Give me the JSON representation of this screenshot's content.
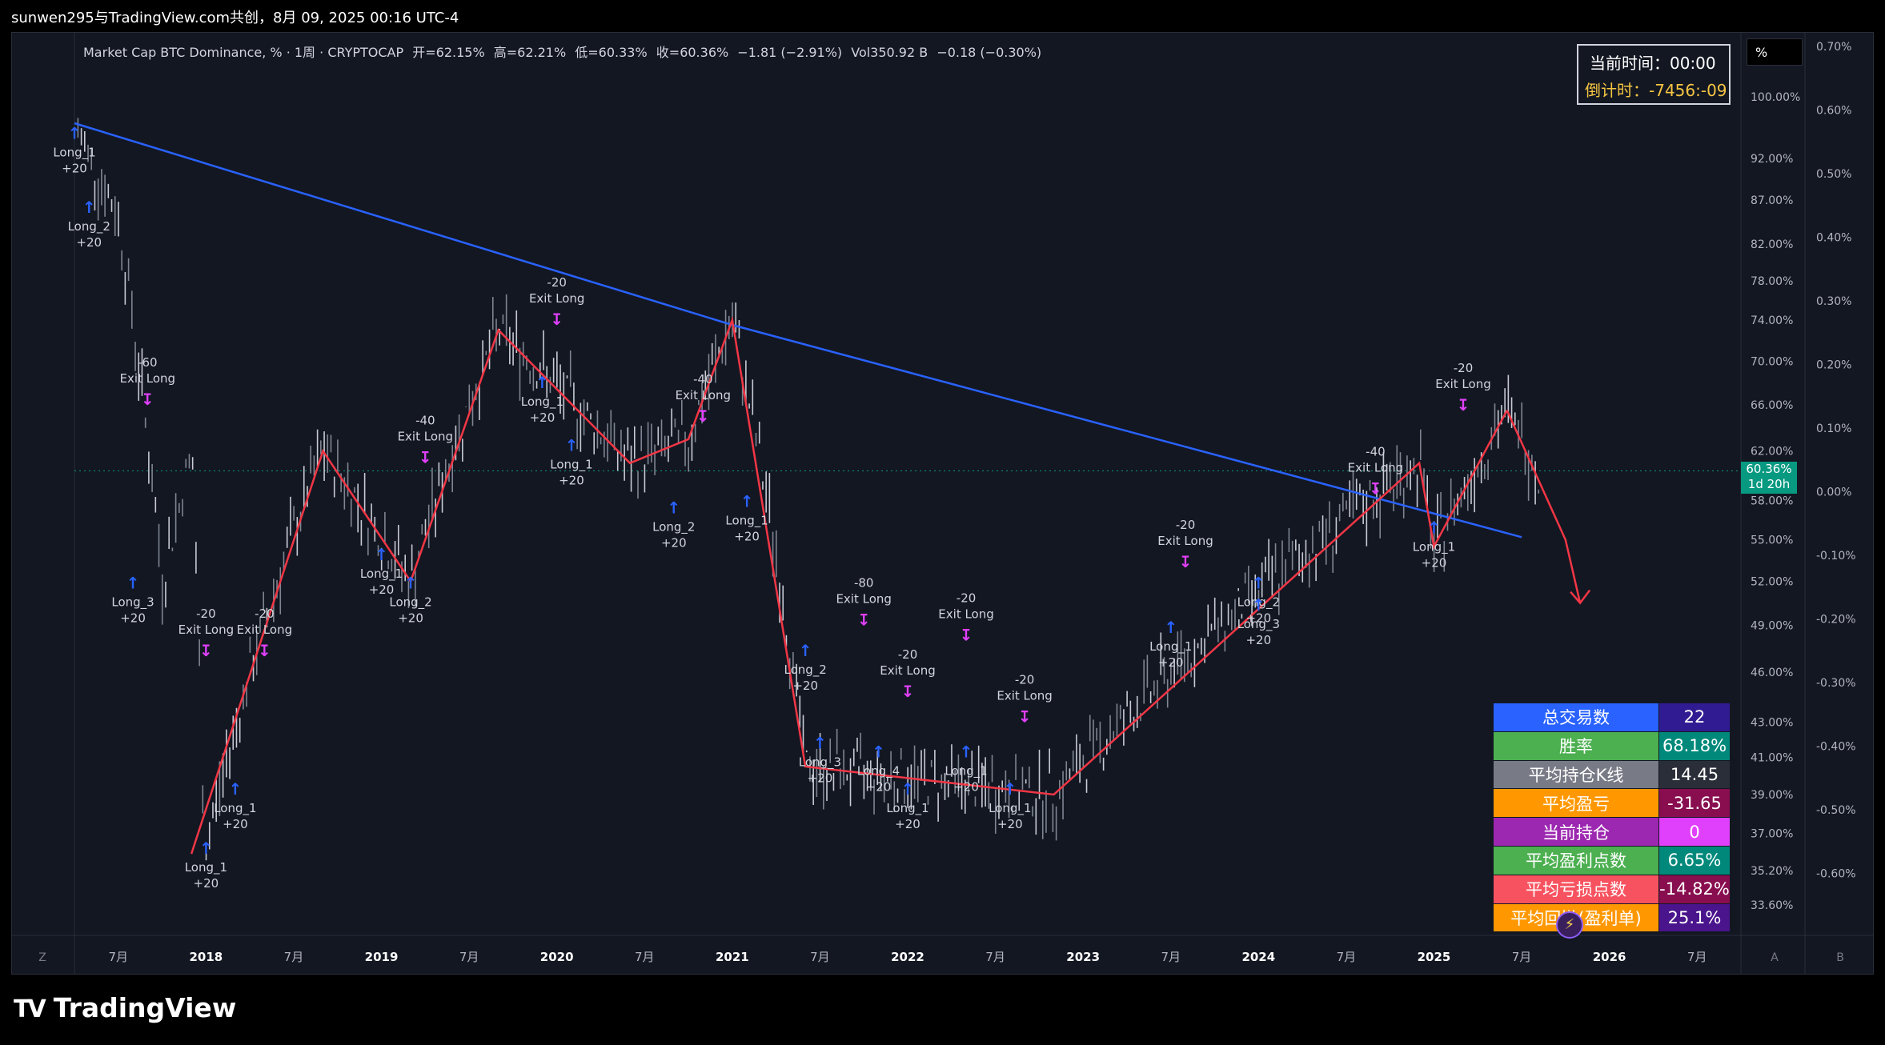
{
  "header": {
    "user_line": "sunwen295与TradingView.com共创，8月 09, 2025 00:16 UTC-4"
  },
  "legend": {
    "symbol": "Market Cap BTC Dominance, % · 1周 · CRYPTOCAP",
    "open": "开=62.15%",
    "high": "高=62.21%",
    "low": "低=60.33%",
    "close": "收=60.36%",
    "change": "−1.81 (−2.91%)",
    "vol": "Vol350.92 B",
    "vol_change": "−0.18 (−0.30%)"
  },
  "timebox": {
    "now": "当前时间：00:00",
    "countdown": "倒计时：-7456:-09"
  },
  "percent_button": "%",
  "price_tag": {
    "value": "60.36%",
    "remaining": "1d 20h"
  },
  "stats": [
    {
      "label": "总交易数",
      "value": "22",
      "label_color": "#2962ff",
      "value_color": "#311b92"
    },
    {
      "label": "胜率",
      "value": "68.18%",
      "label_color": "#4caf50",
      "value_color": "#00897b"
    },
    {
      "label": "平均持仓K线",
      "value": "14.45",
      "label_color": "#787b86",
      "value_color": "#2a2e39"
    },
    {
      "label": "平均盈亏",
      "value": "-31.65",
      "label_color": "#ff9800",
      "value_color": "#880e4f"
    },
    {
      "label": "当前持仓",
      "value": "0",
      "label_color": "#9c27b0",
      "value_color": "#e040fb"
    },
    {
      "label": "平均盈利点数",
      "value": "6.65%",
      "label_color": "#4caf50",
      "value_color": "#00897b"
    },
    {
      "label": "平均亏损点数",
      "value": "-14.82%",
      "label_color": "#f7525f",
      "value_color": "#880e4f"
    },
    {
      "label": "平均回撤(盈利单)",
      "value": "25.1%",
      "label_color": "#ff9800",
      "value_color": "#4a148c"
    }
  ],
  "axis_letters": {
    "left": "Z",
    "A": "A",
    "B": "B"
  },
  "brand": "TradingView",
  "chart_data": {
    "type": "candlestick",
    "y_axis_right": [
      "100.00%",
      "92.00%",
      "87.00%",
      "82.00%",
      "78.00%",
      "74.00%",
      "70.00%",
      "66.00%",
      "62.00%",
      "58.00%",
      "55.00%",
      "52.00%",
      "49.00%",
      "46.00%",
      "43.00%",
      "41.00%",
      "39.00%",
      "37.00%",
      "35.20%",
      "33.60%"
    ],
    "y_axis_values": [
      100,
      92,
      87,
      82,
      78,
      74,
      70,
      66,
      62,
      58,
      55,
      52,
      49,
      46,
      43,
      41,
      39,
      37,
      35.2,
      33.6
    ],
    "y_axis_secondary": [
      "0.70%",
      "0.60%",
      "0.50%",
      "0.40%",
      "0.30%",
      "0.20%",
      "0.10%",
      "0.00%",
      "-0.10%",
      "-0.20%",
      "-0.30%",
      "-0.40%",
      "-0.50%",
      "-0.60%"
    ],
    "x_axis": [
      "7月",
      "2018",
      "7月",
      "2019",
      "7月",
      "2020",
      "7月",
      "2021",
      "7月",
      "2022",
      "7月",
      "2023",
      "7月",
      "2024",
      "7月",
      "2025",
      "7月",
      "2026",
      "7月"
    ],
    "y_scale": "log",
    "last_price": 60.36,
    "trend_line": [
      {
        "x": "2017-04",
        "y": 96.5
      },
      {
        "x": "2021-01",
        "y": 73.5
      },
      {
        "x": "2025-07",
        "y": 55.2
      }
    ],
    "zigzag": [
      {
        "x": "2017-12",
        "y": 36
      },
      {
        "x": "2018-09",
        "y": 62
      },
      {
        "x": "2019-03",
        "y": 52
      },
      {
        "x": "2019-09",
        "y": 73
      },
      {
        "x": "2020-06",
        "y": 61
      },
      {
        "x": "2020-10",
        "y": 63
      },
      {
        "x": "2021-01",
        "y": 74
      },
      {
        "x": "2021-06",
        "y": 40.5
      },
      {
        "x": "2022-11",
        "y": 39
      },
      {
        "x": "2024-12",
        "y": 61
      },
      {
        "x": "2025-01",
        "y": 54.5
      },
      {
        "x": "2025-06",
        "y": 65.5
      }
    ],
    "projection": [
      {
        "x": "2025-06",
        "y": 65.5
      },
      {
        "x": "2025-10",
        "y": 55
      },
      {
        "x": "2025-11",
        "y": 50.5
      }
    ],
    "annotations": [
      {
        "text": "Long_1\n+20",
        "kind": "long",
        "x": "2017-04",
        "y": 94.5
      },
      {
        "text": "Long_2\n+20",
        "kind": "long",
        "x": "2017-05",
        "y": 85.5
      },
      {
        "text": "Long_3\n+20",
        "kind": "long",
        "x": "2017-08",
        "y": 51.5
      },
      {
        "text": "-60\nExit Long",
        "kind": "exit",
        "x": "2017-09",
        "y": 66
      },
      {
        "text": "Long_1\n+20",
        "kind": "long",
        "x": "2018-01",
        "y": 36
      },
      {
        "text": "-20\nExit Long",
        "kind": "exit",
        "x": "2018-01",
        "y": 47
      },
      {
        "text": "Long_1\n+20",
        "kind": "long",
        "x": "2018-03",
        "y": 39
      },
      {
        "text": "-20\nExit Long",
        "kind": "exit",
        "x": "2018-05",
        "y": 47
      },
      {
        "text": "Long_1\n+20",
        "kind": "long",
        "x": "2019-01",
        "y": 53.5
      },
      {
        "text": "Long_2\n+20",
        "kind": "long",
        "x": "2019-03",
        "y": 51.5
      },
      {
        "text": "-40\nExit Long",
        "kind": "exit",
        "x": "2019-04",
        "y": 61
      },
      {
        "text": "Long_1\n+20",
        "kind": "long",
        "x": "2019-12",
        "y": 67.5
      },
      {
        "text": "-20\nExit Long",
        "kind": "exit",
        "x": "2020-01",
        "y": 73.5
      },
      {
        "text": "Long_1\n+20",
        "kind": "long",
        "x": "2020-02",
        "y": 62
      },
      {
        "text": "Long_2\n+20",
        "kind": "long",
        "x": "2020-09",
        "y": 57
      },
      {
        "text": "-40\nExit Long",
        "kind": "exit",
        "x": "2020-11",
        "y": 64.5
      },
      {
        "text": "Long_1\n+20",
        "kind": "long",
        "x": "2021-02",
        "y": 57.5
      },
      {
        "text": "Long_2\n+20",
        "kind": "long",
        "x": "2021-06",
        "y": 47
      },
      {
        "text": "Long_3\n+20",
        "kind": "long",
        "x": "2021-07",
        "y": 41.5
      },
      {
        "text": "-80\nExit Long",
        "kind": "exit",
        "x": "2021-10",
        "y": 49
      },
      {
        "text": "Long_4\n+20",
        "kind": "long",
        "x": "2021-11",
        "y": 41
      },
      {
        "text": "-20\nExit Long",
        "kind": "exit",
        "x": "2022-01",
        "y": 44.5
      },
      {
        "text": "Long_1\n+20",
        "kind": "long",
        "x": "2022-01",
        "y": 39
      },
      {
        "text": "-20\nExit Long",
        "kind": "exit",
        "x": "2022-05",
        "y": 48
      },
      {
        "text": "Long_1\n+20",
        "kind": "long",
        "x": "2022-05",
        "y": 41
      },
      {
        "text": "-20\nExit Long",
        "kind": "exit",
        "x": "2022-09",
        "y": 43
      },
      {
        "text": "Long_1\n+20",
        "kind": "long",
        "x": "2022-08",
        "y": 39
      },
      {
        "text": "Long_1\n+20",
        "kind": "long",
        "x": "2023-07",
        "y": 48.5
      },
      {
        "text": "-20\nExit Long",
        "kind": "exit",
        "x": "2023-08",
        "y": 53
      },
      {
        "text": "Long_2\n+20",
        "kind": "long",
        "x": "2024-01",
        "y": 51.5
      },
      {
        "text": "Long_3\n+20",
        "kind": "long",
        "x": "2024-01",
        "y": 50
      },
      {
        "text": "-40\nExit Long",
        "kind": "exit",
        "x": "2024-09",
        "y": 58.5
      },
      {
        "text": "Long_1\n+20",
        "kind": "long",
        "x": "2025-01",
        "y": 55.5
      },
      {
        "text": "-20\nExit Long",
        "kind": "exit",
        "x": "2025-03",
        "y": 65.5
      }
    ]
  }
}
